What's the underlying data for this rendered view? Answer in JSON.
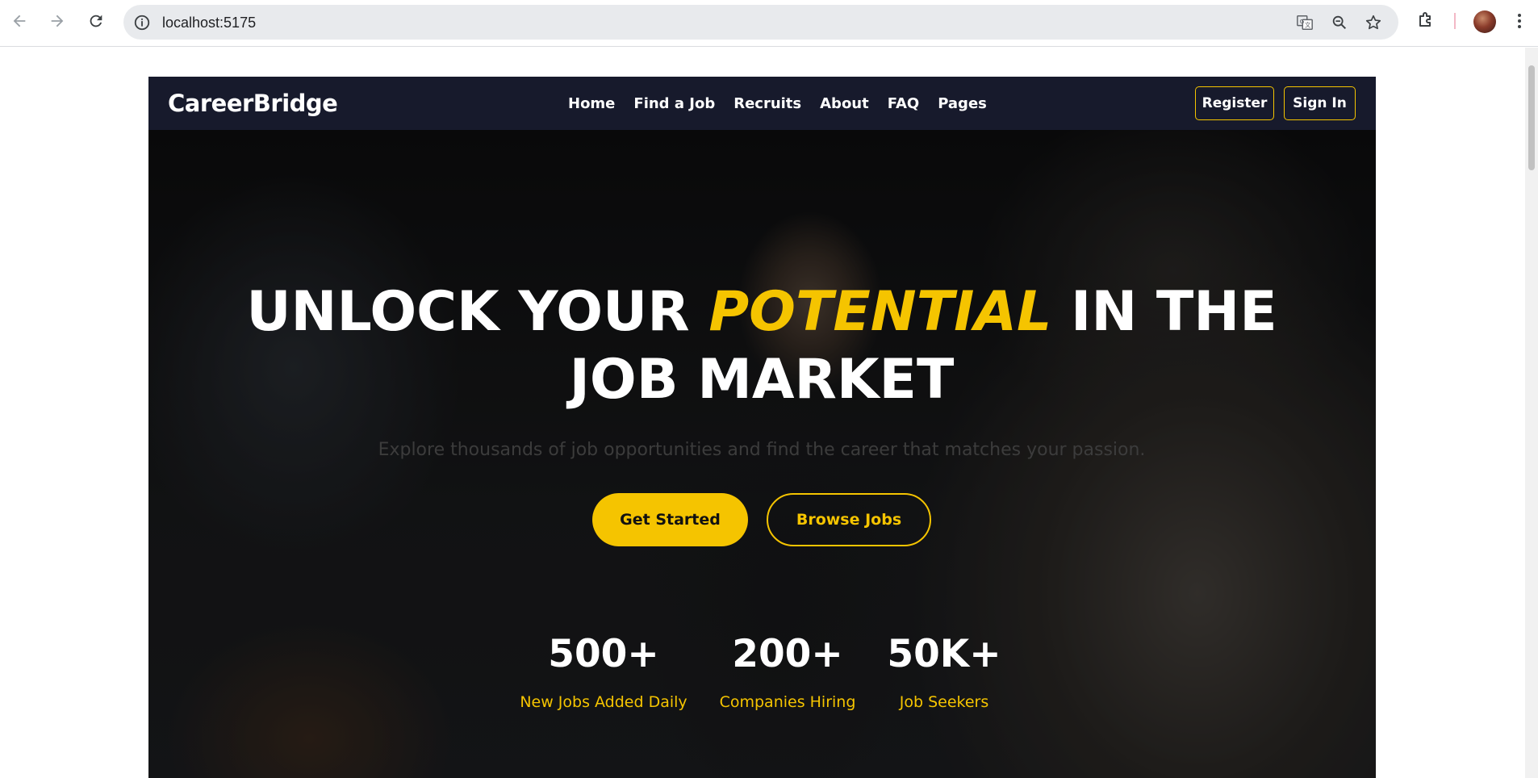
{
  "browser": {
    "url": "localhost:5175",
    "icons": {
      "back": "arrow-left-icon",
      "forward": "arrow-right-icon",
      "reload": "reload-icon",
      "info": "info-icon",
      "translate": "translate-icon",
      "zoom": "zoom-icon",
      "bookmark": "star-icon",
      "extensions": "puzzle-icon",
      "menu": "kebab-icon"
    }
  },
  "site": {
    "brand": "CareerBridge",
    "nav": [
      "Home",
      "Find a Job",
      "Recruits",
      "About",
      "FAQ",
      "Pages"
    ],
    "register_label": "Register",
    "signin_label": "Sign In"
  },
  "hero": {
    "title_before": "UNLOCK YOUR ",
    "title_accent": "POTENTIAL",
    "title_after": " IN THE JOB MARKET",
    "subtitle": "Explore thousands of job opportunities and find the career that matches your passion.",
    "primary_cta": "Get Started",
    "secondary_cta": "Browse Jobs"
  },
  "stats": [
    {
      "value": "500+",
      "label": "New Jobs Added Daily"
    },
    {
      "value": "200+",
      "label": "Companies Hiring"
    },
    {
      "value": "50K+",
      "label": "Job Seekers"
    }
  ],
  "colors": {
    "accent": "#f5c400",
    "header_bg": "#171a2c"
  }
}
